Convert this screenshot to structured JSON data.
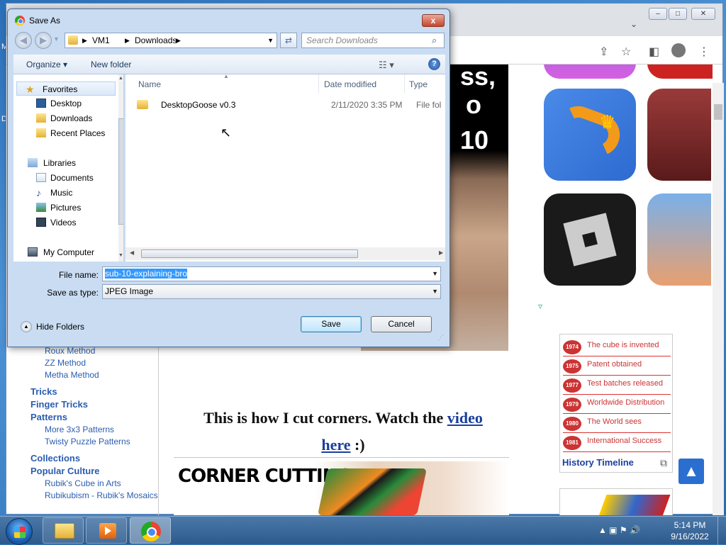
{
  "desktop": {
    "left_labels": [
      "M",
      "D"
    ]
  },
  "browser": {
    "window_controls": {
      "minimize": "–",
      "maximize": "□",
      "close": "✕"
    },
    "tab_dropdown_icon": "chevron-down-icon",
    "toolbar_icons": [
      "share-icon",
      "star-icon",
      "sidepanel-icon",
      "profile-icon",
      "menu-dots-icon"
    ]
  },
  "page": {
    "sidebar_sub_top": [
      "Roux Method",
      "ZZ Method",
      "Metha Method"
    ],
    "sidebar_main": [
      "Tricks",
      "Finger Tricks",
      "Patterns"
    ],
    "sidebar_sub_patterns": [
      "More 3x3 Patterns",
      "Twisty Puzzle Patterns"
    ],
    "sidebar_main_2": [
      "Collections",
      "Popular Culture"
    ],
    "sidebar_sub_culture": [
      "Rubik's Cube in Arts",
      "Rubikubism - Rubik's Mosaics"
    ],
    "video_text": [
      "ss,",
      "o",
      "10"
    ],
    "caption": {
      "text_before": "This is how I cut corners. Watch the",
      "link_1": "video",
      "link_2": "here",
      "text_after": ":)"
    },
    "corner_image_title": "CORNER CUTTING",
    "timeline": {
      "rows": [
        {
          "year": "1974",
          "text": "The cube is invented"
        },
        {
          "year": "1975",
          "text": "Patent obtained"
        },
        {
          "year": "1977",
          "text": "Test batches released"
        },
        {
          "year": "1979",
          "text": "Worldwide Distribution"
        },
        {
          "year": "1980",
          "text": "The World sees"
        },
        {
          "year": "1981",
          "text": "International Success"
        }
      ],
      "caption": "History Timeline"
    },
    "scroll_top_icon": "arrow-up-icon"
  },
  "dialog": {
    "title": "Save As",
    "close_label": "x",
    "breadcrumb": [
      "VM1",
      "Downloads"
    ],
    "search_placeholder": "Search Downloads",
    "commands": {
      "organize": "Organize ▾",
      "new_folder": "New folder",
      "help": "?"
    },
    "nav": {
      "favorites": "Favorites",
      "favorites_items": [
        "Desktop",
        "Downloads",
        "Recent Places"
      ],
      "libraries": "Libraries",
      "libraries_items": [
        "Documents",
        "Music",
        "Pictures",
        "Videos"
      ],
      "computer": "My Computer"
    },
    "columns": [
      "Name",
      "Date modified",
      "Type"
    ],
    "files": [
      {
        "name": "DesktopGoose v0.3",
        "date": "2/11/2020 3:35 PM",
        "type": "File folder"
      }
    ],
    "file_name_label": "File name:",
    "file_name_value": "sub-10-explaining-bro",
    "save_type_label": "Save as type:",
    "save_type_value": "JPEG Image",
    "hide_folders": "Hide Folders",
    "save_button": "Save",
    "cancel_button": "Cancel"
  },
  "taskbar": {
    "apps": [
      "explorer",
      "media-player",
      "chrome"
    ],
    "tray_icons": "▲  ▣  ⚑  🔊",
    "time": "5:14 PM",
    "date": "9/16/2022"
  }
}
